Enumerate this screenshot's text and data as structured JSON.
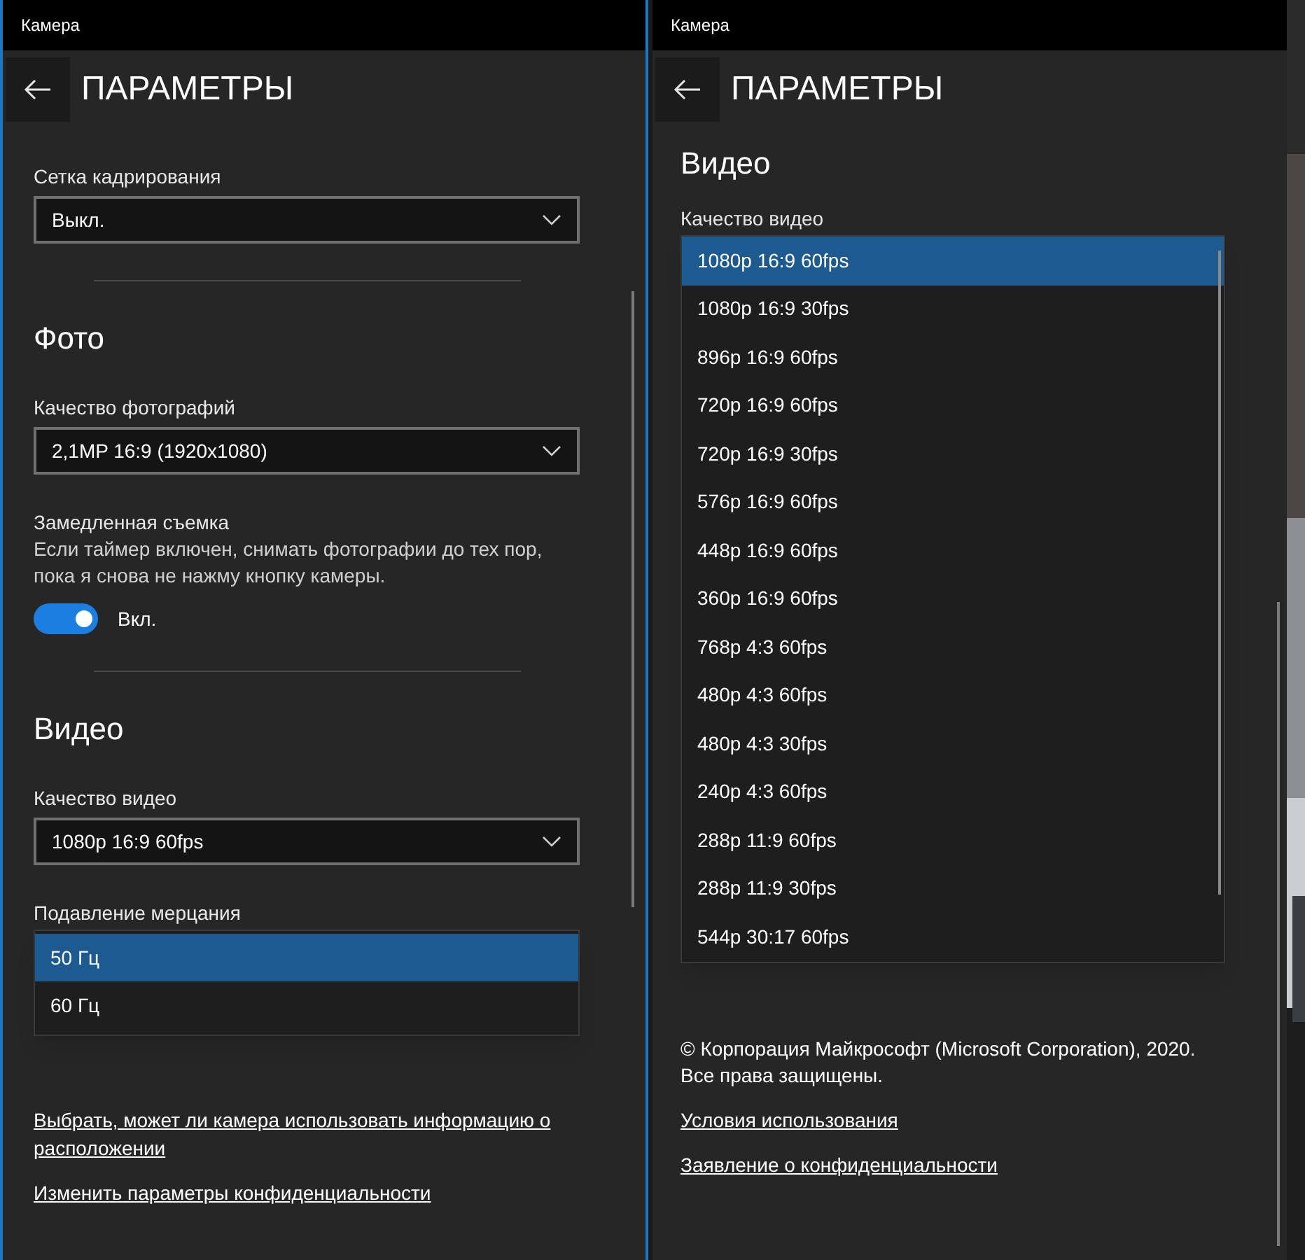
{
  "windows": [
    {
      "title": "Камера",
      "header": "ПАРАМЕТРЫ",
      "items": [
        {
          "kind": "dropdown",
          "label": "Сетка кадрирования",
          "value": "Выкл."
        },
        {
          "kind": "divider"
        },
        {
          "kind": "heading",
          "text": "Фото"
        },
        {
          "kind": "dropdown",
          "label": "Качество фотографий",
          "value": "2,1MP 16:9 (1920x1080)"
        },
        {
          "kind": "toggle",
          "label": "Замедленная съемка",
          "description": "Если таймер включен, снимать фотографии до тех пор, пока я снова не нажму кнопку камеры.",
          "on": true,
          "state_label": "Вкл."
        },
        {
          "kind": "divider"
        },
        {
          "kind": "heading",
          "text": "Видео"
        },
        {
          "kind": "dropdown",
          "label": "Качество видео",
          "value": "1080p 16:9 60fps"
        },
        {
          "kind": "open_dropdown",
          "label": "Подавление мерцания",
          "options": [
            {
              "label": "50 Гц",
              "selected": true
            },
            {
              "label": "60 Гц",
              "selected": false
            }
          ]
        },
        {
          "kind": "link",
          "text": "Выбрать, может ли камера использовать информацию о расположении"
        },
        {
          "kind": "link",
          "text": "Изменить параметры конфиденциальности"
        }
      ]
    },
    {
      "title": "Камера",
      "header": "ПАРАМЕТРЫ",
      "items": [
        {
          "kind": "heading",
          "text": "Видео"
        },
        {
          "kind": "open_dropdown",
          "label": "Качество видео",
          "options": [
            {
              "label": "1080p 16:9 60fps",
              "selected": true
            },
            {
              "label": "1080p 16:9 30fps",
              "selected": false
            },
            {
              "label": "896p 16:9 60fps",
              "selected": false
            },
            {
              "label": "720p 16:9 60fps",
              "selected": false
            },
            {
              "label": "720p 16:9 30fps",
              "selected": false
            },
            {
              "label": "576p 16:9 60fps",
              "selected": false
            },
            {
              "label": "448p 16:9 60fps",
              "selected": false
            },
            {
              "label": "360p 16:9 60fps",
              "selected": false
            },
            {
              "label": "768p 4:3 60fps",
              "selected": false
            },
            {
              "label": "480p 4:3 60fps",
              "selected": false
            },
            {
              "label": "480p 4:3 30fps",
              "selected": false
            },
            {
              "label": "240p 4:3 60fps",
              "selected": false
            },
            {
              "label": "288p 11:9 60fps",
              "selected": false
            },
            {
              "label": "288p 11:9 30fps",
              "selected": false
            },
            {
              "label": "544p 30:17 60fps",
              "selected": false
            }
          ]
        },
        {
          "kind": "text",
          "text": "© Корпорация Майкрософт (Microsoft Corporation), 2020. Все права защищены."
        },
        {
          "kind": "link",
          "text": "Условия использования"
        },
        {
          "kind": "link",
          "text": "Заявление о конфиденциальности"
        }
      ]
    }
  ]
}
